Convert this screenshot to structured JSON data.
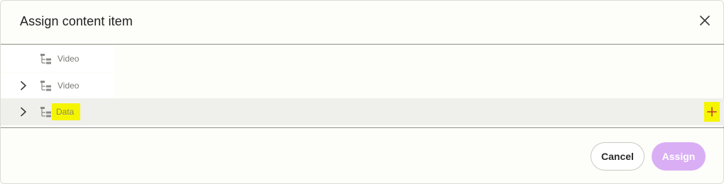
{
  "dialog": {
    "title": "Assign content item",
    "close_icon": "close-icon"
  },
  "tree": {
    "items": [
      {
        "label": "Video",
        "expandable": false,
        "selected": false,
        "icon": "tree-hierarchy-icon"
      },
      {
        "label": "Video",
        "expandable": true,
        "selected": false,
        "icon": "tree-hierarchy-icon"
      },
      {
        "label": "Data",
        "expandable": true,
        "selected": true,
        "highlighted": true,
        "icon": "tree-hierarchy-icon"
      }
    ],
    "add_icon": "plus-icon"
  },
  "footer": {
    "cancel_label": "Cancel",
    "assign_label": "Assign"
  },
  "colors": {
    "highlight": "#f5f500",
    "assign_disabled": "#d9aef5",
    "selected_row": "#efefeb"
  }
}
